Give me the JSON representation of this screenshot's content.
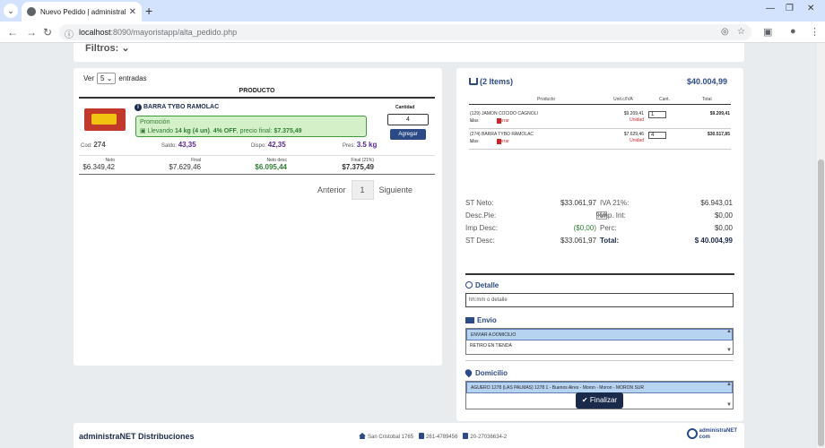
{
  "browser": {
    "tab_title": "Nuevo Pedido | administraNET ...",
    "tab_close": "✕",
    "new_tab": "+",
    "url_host": "localhost",
    "url_path": ":8090/mayoristapp/alta_pedido.php"
  },
  "filters": {
    "label": "Filtros:"
  },
  "list": {
    "show_label": "Ver",
    "page_size": "5",
    "entries_label": "entradas",
    "column_header": "PRODUCTO"
  },
  "product": {
    "name": "BARRA TYBO RAMOLAC",
    "promo_title": "Promoción",
    "promo_pre": "Llevando ",
    "promo_qty": "14 kg (4 un)",
    "promo_mid": ". ",
    "promo_off": "4% OFF",
    "promo_post": ", precio final: ",
    "promo_price": "$7.375,49",
    "qty_label": "Cantidad",
    "qty_value": "4",
    "add_label": "Agregar",
    "cod_label": "Cod:",
    "cod_value": "274",
    "saldo_label": "Saldo:",
    "saldo_value": "43,35",
    "dispo_label": "Dispo:",
    "dispo_value": "42,35",
    "pres_label": "Pres:",
    "pres_value": "3.5 kg",
    "neto_label": "Neto",
    "neto_value": "$6.349,42",
    "final_label": "Final",
    "final_value": "$7.629,46",
    "netodesc_label": "Neto desc",
    "netodesc_value": "$6.095,44",
    "final21_label": "Final (21%)",
    "final21_value": "$7.375,49"
  },
  "pager": {
    "prev": "Anterior",
    "page": "1",
    "next": "Siguiente"
  },
  "cart": {
    "items_label": "(2 Items)",
    "total": "$40.004,99",
    "headers": {
      "producto": "Producto",
      "unit": "Unit.c/IVA",
      "cant": "Cant.",
      "total": "Total"
    },
    "rows": [
      {
        "name": "(129) JAMON COCIDO CAGNOLI",
        "unit_price": "$9.209,41",
        "unit_label": "Unidad",
        "qty": "1",
        "total": "$9.209,41",
        "mas": "Mas",
        "borrar": "Borrar"
      },
      {
        "name": "(274) BARRA TYBO RAMOLAC",
        "unit_price": "$7.629,46",
        "unit_label": "Unidad",
        "qty": "4",
        "total": "$30.517,85",
        "mas": "Mas",
        "borrar": "Borrar"
      }
    ]
  },
  "totals": {
    "st_neto_label": "ST Neto:",
    "st_neto": "$33.061,97",
    "iva_label": "IVA 21%:",
    "iva": "$6.943,01",
    "desc_pie_label": "Desc.Pie:",
    "desc_pie": "0",
    "desc_pct": "%",
    "imp_int_label": "Imp. Int:",
    "imp_int": "$0,00",
    "imp_desc_label": "Imp Desc:",
    "imp_desc": "($0,00)",
    "perc_label": "Perc:",
    "perc": "$0,00",
    "st_desc_label": "ST Desc:",
    "st_desc": "$33.061,97",
    "total_label": "Total:",
    "total": "$ 40.004,99"
  },
  "detalle": {
    "title": "Detalle",
    "placeholder": "hh:mm o detalle"
  },
  "envio": {
    "title": "Envio",
    "options": [
      "ENVIAR A DOMICILIO",
      "RETIRO EN TIENDA"
    ]
  },
  "domicilio": {
    "title": "Domicilio",
    "options": [
      "AGUERO 1278 (LAS PALMAS) 1278 1 - Buenos Aires - Moron - Moron - MORON SUR"
    ]
  },
  "finalizar": "Finalizar",
  "footer": {
    "brand": "administraNET Distribuciones",
    "address": "San Cristobal 1765",
    "phone1": "261-4789456",
    "phone2": "20-27036634-2",
    "logo_line1": "administraNET",
    "logo_line2": "com"
  },
  "colors": {
    "accent": "#2c4a86",
    "promo_bg": "#d4f0c9",
    "danger": "#c62828"
  }
}
